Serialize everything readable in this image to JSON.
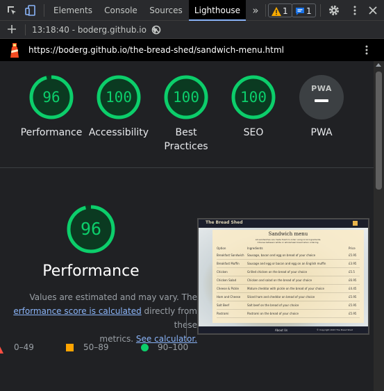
{
  "tabs": {
    "elements": "Elements",
    "console": "Console",
    "sources": "Sources",
    "lighthouse": "Lighthouse",
    "more": "»"
  },
  "badges": {
    "warnings": "1",
    "messages": "1"
  },
  "toolbar": {
    "report_selector": "13:18:40 - boderg.github.io"
  },
  "url": "https://boderg.github.io/the-bread-shed/sandwich-menu.html",
  "categories": [
    {
      "score": "96",
      "label": "Performance",
      "value": 0.96
    },
    {
      "score": "100",
      "label": "Accessibility",
      "value": 1.0
    },
    {
      "score": "100",
      "label": "Best Practices",
      "label_line1": "Best",
      "label_line2": "Practices",
      "value": 1.0
    },
    {
      "score": "100",
      "label": "SEO",
      "value": 1.0
    },
    {
      "score": "PWA",
      "label": "PWA"
    }
  ],
  "performance": {
    "score": "96",
    "value": 0.96,
    "title": "Performance",
    "desc1": "Values are estimated and may vary. The",
    "link1": "erformance score is calculated",
    "desc2": " directly from these",
    "desc3": "metrics. ",
    "link2": "See calculator."
  },
  "legend": {
    "fail": "0–49",
    "average": "50–89",
    "pass": "90–100"
  },
  "thumbnail": {
    "brand": "The Bread Shed",
    "menu_title": "Sandwich menu",
    "intro1": "All sandwiches are made fresh to order using local ingredients.",
    "intro2": "Choose between white or wholemeal bread when ordering.",
    "col_item": "Option",
    "col_ingredients": "Ingredients",
    "col_price": "Price",
    "rows": [
      {
        "item": "Breakfast Sandwich",
        "ingr": "Sausage, bacon and egg on bread of your choice",
        "price": "£5.95"
      },
      {
        "item": "Breakfast Muffin",
        "ingr": "Sausage and egg or bacon and egg on an English muffin",
        "price": "£3.95"
      },
      {
        "item": "Chicken",
        "ingr": "Grilled chicken on the bread of your choice",
        "price": "£5.5"
      },
      {
        "item": "Chicken Salad",
        "ingr": "Chicken and salad on the bread of your choice",
        "price": "£6.95"
      },
      {
        "item": "Cheese & Pickle",
        "ingr": "Mature cheddar with pickle on the bread of your choice",
        "price": "£4.45"
      },
      {
        "item": "Ham and Cheese",
        "ingr": "Sliced ham and cheddar on bread of your choice",
        "price": "£5.95"
      },
      {
        "item": "Salt Beef",
        "ingr": "Salt beef on the bread of your choice",
        "price": "£5.95"
      },
      {
        "item": "Pastrami",
        "ingr": "Pastrami on the bread of your choice",
        "price": "£5.95"
      }
    ],
    "footer_about": "About Us",
    "footer_copy": "© Copyright 2023 The Bread Shed"
  },
  "colors": {
    "pass": "#0cce6b",
    "average": "#ffa400",
    "fail": "#ff4e42",
    "link": "#8ab4f8"
  }
}
